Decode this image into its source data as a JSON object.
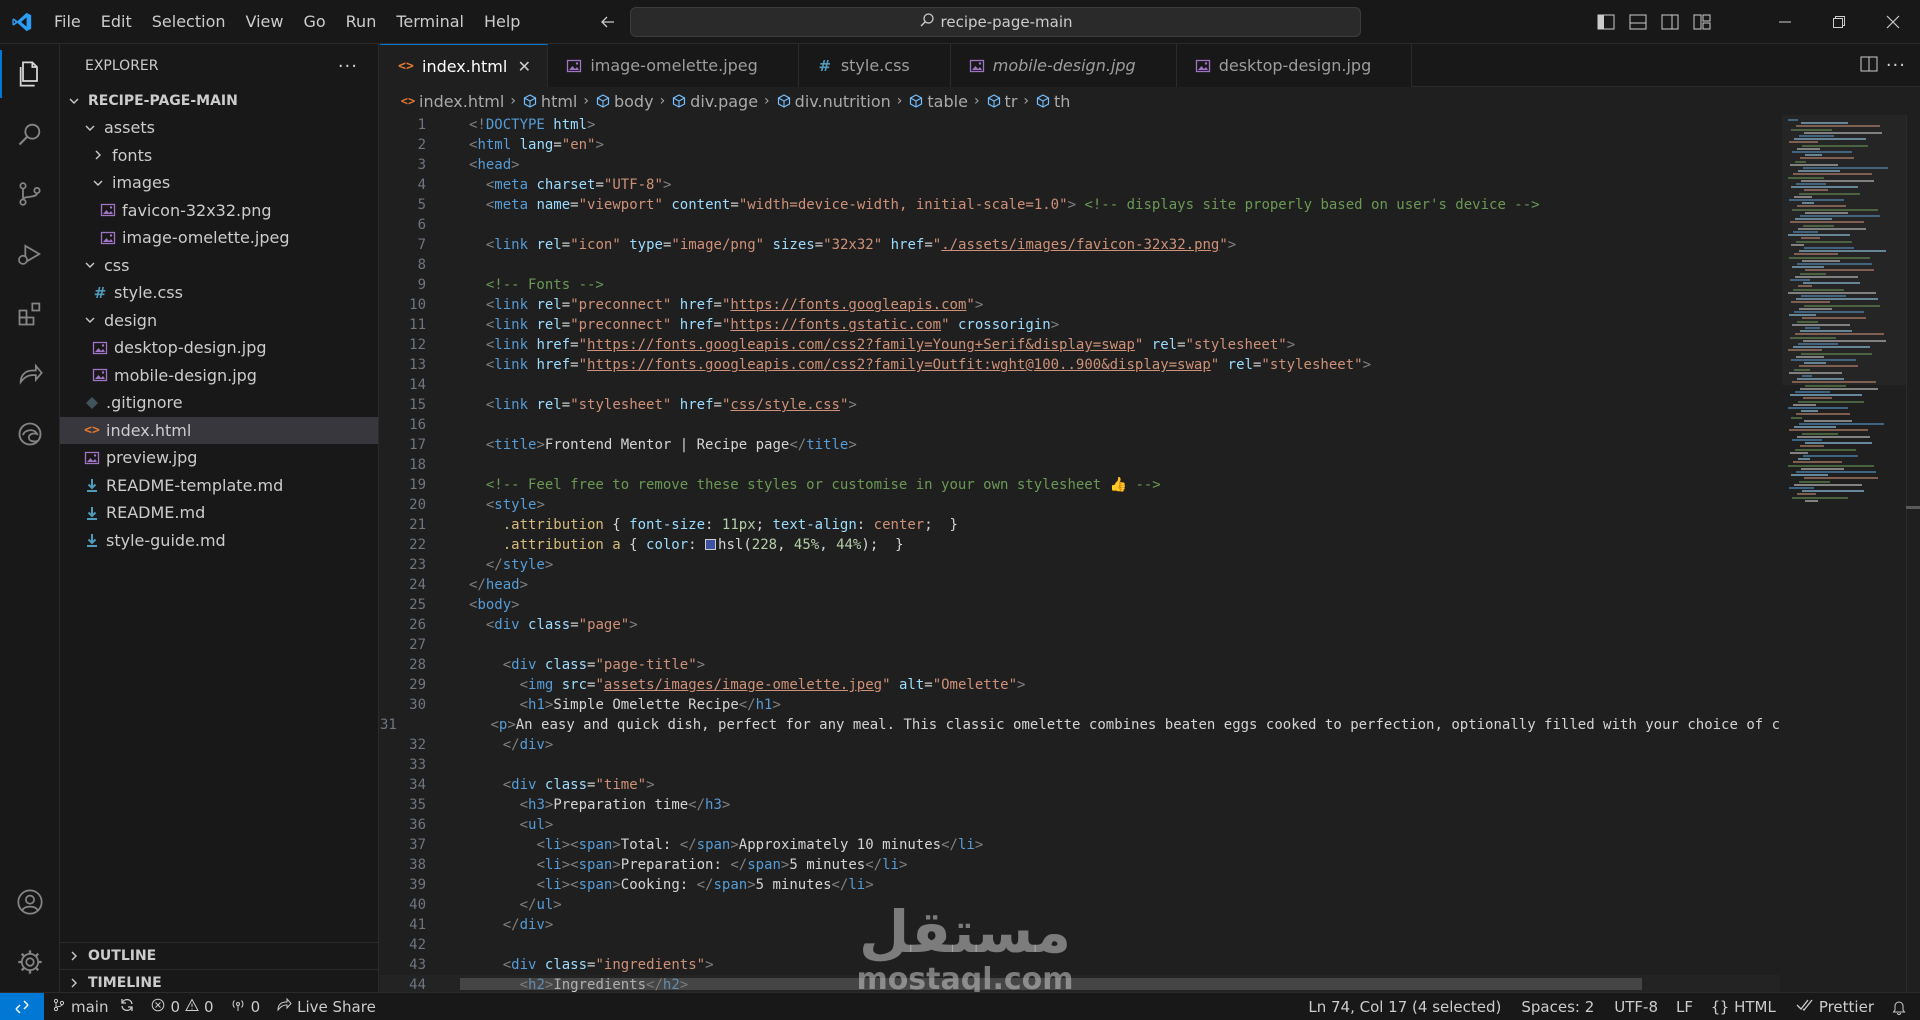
{
  "menu": [
    "File",
    "Edit",
    "Selection",
    "View",
    "Go",
    "Run",
    "Terminal",
    "Help"
  ],
  "command_center": {
    "text": "recipe-page-main"
  },
  "sidebar": {
    "title": "EXPLORER",
    "root": "RECIPE-PAGE-MAIN",
    "tree": [
      {
        "label": "assets",
        "type": "folder",
        "depth": 1,
        "open": true
      },
      {
        "label": "fonts",
        "type": "folder",
        "depth": 2,
        "open": false
      },
      {
        "label": "images",
        "type": "folder",
        "depth": 2,
        "open": true
      },
      {
        "label": "favicon-32x32.png",
        "type": "image",
        "depth": 3
      },
      {
        "label": "image-omelette.jpeg",
        "type": "image",
        "depth": 3
      },
      {
        "label": "css",
        "type": "folder",
        "depth": 1,
        "open": true
      },
      {
        "label": "style.css",
        "type": "css",
        "depth": 2
      },
      {
        "label": "design",
        "type": "folder",
        "depth": 1,
        "open": true
      },
      {
        "label": "desktop-design.jpg",
        "type": "image",
        "depth": 2
      },
      {
        "label": "mobile-design.jpg",
        "type": "image",
        "depth": 2
      },
      {
        "label": ".gitignore",
        "type": "git",
        "depth": 1
      },
      {
        "label": "index.html",
        "type": "html",
        "depth": 1,
        "selected": true
      },
      {
        "label": "preview.jpg",
        "type": "image",
        "depth": 1
      },
      {
        "label": "README-template.md",
        "type": "md",
        "depth": 1
      },
      {
        "label": "README.md",
        "type": "md",
        "depth": 1
      },
      {
        "label": "style-guide.md",
        "type": "md",
        "depth": 1
      }
    ],
    "outline": "OUTLINE",
    "timeline": "TIMELINE"
  },
  "tabs": [
    {
      "label": "index.html",
      "type": "html",
      "active": true,
      "italic": false
    },
    {
      "label": "image-omelette.jpeg",
      "type": "image",
      "active": false,
      "italic": false
    },
    {
      "label": "style.css",
      "type": "css",
      "active": false,
      "italic": false
    },
    {
      "label": "mobile-design.jpg",
      "type": "image",
      "active": false,
      "italic": true
    },
    {
      "label": "desktop-design.jpg",
      "type": "image",
      "active": false,
      "italic": false
    }
  ],
  "breadcrumb": [
    "index.html",
    "html",
    "body",
    "div.page",
    "div.nutrition",
    "table",
    "tr",
    "th"
  ],
  "code_lines": [
    "<!DOCTYPE html>",
    "<html lang=\"en\">",
    "<head>",
    "  <meta charset=\"UTF-8\">",
    "  <meta name=\"viewport\" content=\"width=device-width, initial-scale=1.0\"> <!-- displays site properly based on user's device -->",
    "",
    "  <link rel=\"icon\" type=\"image/png\" sizes=\"32x32\" href=\"./assets/images/favicon-32x32.png\">",
    "",
    "  <!-- Fonts -->",
    "  <link rel=\"preconnect\" href=\"https://fonts.googleapis.com\">",
    "  <link rel=\"preconnect\" href=\"https://fonts.gstatic.com\" crossorigin>",
    "  <link href=\"https://fonts.googleapis.com/css2?family=Young+Serif&display=swap\" rel=\"stylesheet\">",
    "  <link href=\"https://fonts.googleapis.com/css2?family=Outfit:wght@100..900&display=swap\" rel=\"stylesheet\">",
    "",
    "  <link rel=\"stylesheet\" href=\"css/style.css\">",
    "",
    "  <title>Frontend Mentor | Recipe page</title>",
    "",
    "  <!-- Feel free to remove these styles or customise in your own stylesheet 👍 -->",
    "  <style>",
    "    .attribution { font-size: 11px; text-align: center; }",
    "    .attribution a { color: hsl(228, 45%, 44%); }",
    "  </style>",
    "</head>",
    "<body>",
    "  <div class=\"page\">",
    "",
    "    <div class=\"page-title\">",
    "      <img src=\"assets/images/image-omelette.jpeg\" alt=\"Omelette\">",
    "      <h1>Simple Omelette Recipe</h1>",
    "      <p>An easy and quick dish, perfect for any meal. This classic omelette combines beaten eggs cooked to perfection, optionally filled with your choice of che",
    "    </div>",
    "",
    "    <div class=\"time\">",
    "      <h3>Preparation time</h3>",
    "      <ul>",
    "        <li><span>Total: </span>Approximately 10 minutes</li>",
    "        <li><span>Preparation: </span>5 minutes</li>",
    "        <li><span>Cooking: </span>5 minutes</li>",
    "      </ul>",
    "    </div>",
    "",
    "    <div class=\"ingredients\">",
    "      <h2>Ingredients</h2>"
  ],
  "watermark": {
    "arabic": "مستقل",
    "latin": "mostaql.com"
  },
  "status": {
    "branch": "main",
    "errors": "0",
    "warnings": "0",
    "ports": "0",
    "live_share": "Live Share",
    "position": "Ln 74, Col 17 (4 selected)",
    "spaces": "Spaces: 2",
    "encoding": "UTF-8",
    "eol": "LF",
    "language": "HTML",
    "formatter": "Prettier"
  },
  "colors": {
    "accent": "#0078d4",
    "background": "#1f1f1f",
    "chrome": "#181818"
  }
}
